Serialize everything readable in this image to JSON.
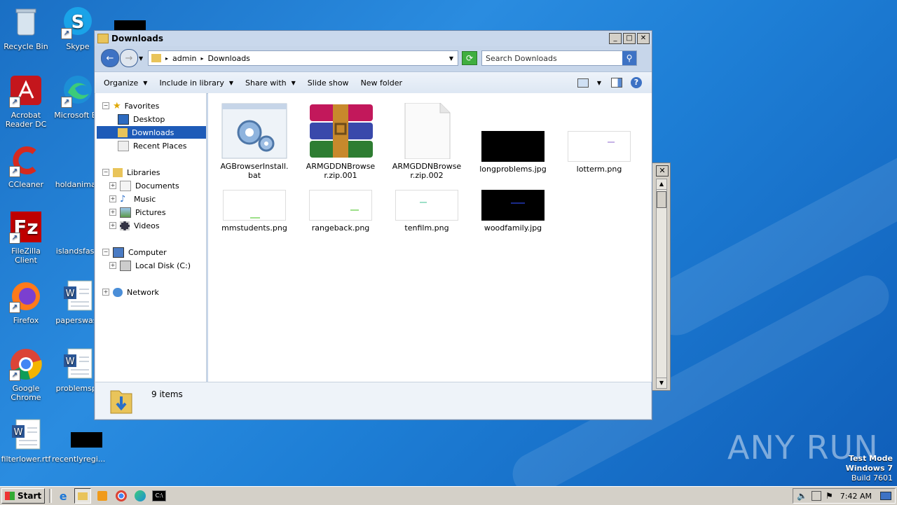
{
  "desktop": {
    "icons": [
      {
        "label": "Recycle Bin"
      },
      {
        "label": "Skype"
      },
      {
        "label": "Acrobat Reader DC"
      },
      {
        "label": "Microsoft Ed"
      },
      {
        "label": "CCleaner"
      },
      {
        "label": "holdanimal."
      },
      {
        "label": "FileZilla Client"
      },
      {
        "label": "islandsfast."
      },
      {
        "label": "Firefox"
      },
      {
        "label": "paperswast"
      },
      {
        "label": "Google Chrome"
      },
      {
        "label": "problemspr"
      },
      {
        "label": "filterlower.rtf"
      },
      {
        "label": "recentlyregi..."
      }
    ],
    "watermark": {
      "brand": "ANY RUN",
      "line1": "Test Mode",
      "line2": "Windows 7",
      "line3": "Build 7601"
    }
  },
  "window": {
    "title": "Downloads",
    "address": {
      "crumbs": [
        "admin",
        "Downloads"
      ]
    },
    "search_placeholder": "Search Downloads",
    "toolbar": {
      "organize": "Organize",
      "include": "Include in library",
      "share": "Share with",
      "slideshow": "Slide show",
      "newfolder": "New folder"
    },
    "nav": {
      "favorites": "Favorites",
      "desktop": "Desktop",
      "downloads": "Downloads",
      "recent": "Recent Places",
      "libraries": "Libraries",
      "documents": "Documents",
      "music": "Music",
      "pictures": "Pictures",
      "videos": "Videos",
      "computer": "Computer",
      "localdisk": "Local Disk (C:)",
      "network": "Network"
    },
    "files": [
      {
        "name": "AGBrowserInstall.bat"
      },
      {
        "name": "ARMGDDNBrowser.zip.001"
      },
      {
        "name": "ARMGDDNBrowser.zip.002"
      },
      {
        "name": "longproblems.jpg"
      },
      {
        "name": "lotterm.png"
      },
      {
        "name": "mmstudents.png"
      },
      {
        "name": "rangeback.png"
      },
      {
        "name": "tenfilm.png"
      },
      {
        "name": "woodfamily.jpg"
      }
    ],
    "status": "9 items"
  },
  "taskbar": {
    "start": "Start",
    "clock": "7:42 AM"
  }
}
